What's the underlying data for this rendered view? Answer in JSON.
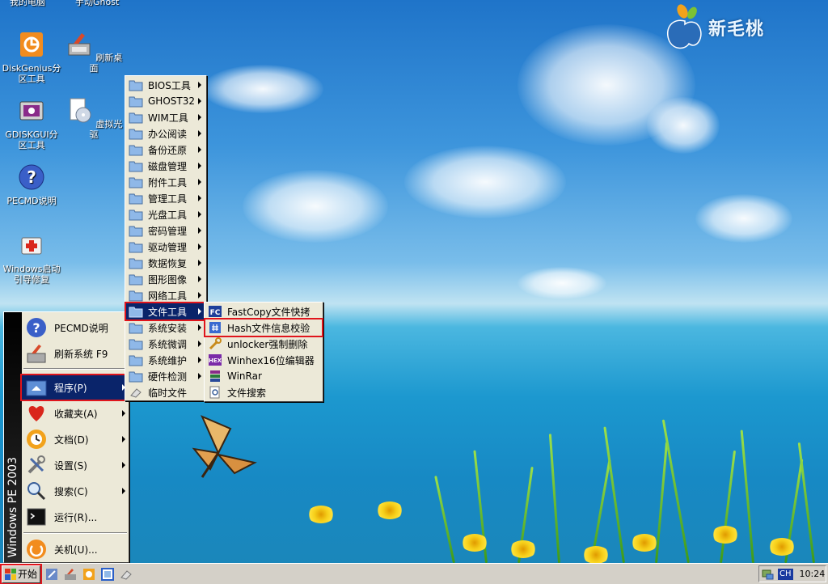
{
  "desktop": {
    "logo_text": "新毛桃",
    "top_cut_labels": [
      "我的电脑",
      "手动Ghost"
    ],
    "icons": [
      {
        "label": "DiskGenius分区工具",
        "icon": "diskgenius-icon"
      },
      {
        "label": "刷新桌面",
        "icon": "refresh-desktop-icon"
      },
      {
        "label": "GDISKGUI分区工具",
        "icon": "gdiskgui-icon"
      },
      {
        "label": "虚拟光驱",
        "icon": "virtual-drive-icon"
      },
      {
        "label": "PECMD说明",
        "icon": "help-icon"
      },
      {
        "label": "Windows启动引导修复",
        "icon": "boot-repair-icon"
      }
    ]
  },
  "start_menu": {
    "banner": "Windows PE 2003",
    "items": [
      {
        "label": "PECMD说明",
        "icon": "help-icon",
        "submenu": false
      },
      {
        "label": "刷新系统 F9",
        "icon": "refresh-icon",
        "submenu": false
      },
      {
        "label": "程序(P)",
        "icon": "programs-icon",
        "submenu": true,
        "active": true
      },
      {
        "label": "收藏夹(A)",
        "icon": "favorites-icon",
        "submenu": true
      },
      {
        "label": "文档(D)",
        "icon": "documents-icon",
        "submenu": true
      },
      {
        "label": "设置(S)",
        "icon": "settings-icon",
        "submenu": true
      },
      {
        "label": "搜索(C)",
        "icon": "search-icon",
        "submenu": true
      },
      {
        "label": "运行(R)...",
        "icon": "run-icon",
        "submenu": false
      },
      {
        "label": "关机(U)...",
        "icon": "shutdown-icon",
        "submenu": false
      }
    ]
  },
  "programs_menu": {
    "items": [
      {
        "label": "BIOS工具",
        "submenu": true
      },
      {
        "label": "GHOST32",
        "submenu": true
      },
      {
        "label": "WIM工具",
        "submenu": true
      },
      {
        "label": "办公阅读",
        "submenu": true
      },
      {
        "label": "备份还原",
        "submenu": true
      },
      {
        "label": "磁盘管理",
        "submenu": true
      },
      {
        "label": "附件工具",
        "submenu": true
      },
      {
        "label": "管理工具",
        "submenu": true
      },
      {
        "label": "光盘工具",
        "submenu": true
      },
      {
        "label": "密码管理",
        "submenu": true
      },
      {
        "label": "驱动管理",
        "submenu": true
      },
      {
        "label": "数据恢复",
        "submenu": true
      },
      {
        "label": "图形图像",
        "submenu": true
      },
      {
        "label": "网络工具",
        "submenu": true
      },
      {
        "label": "文件工具",
        "submenu": true,
        "active": true
      },
      {
        "label": "系统安装",
        "submenu": true
      },
      {
        "label": "系统微调",
        "submenu": true
      },
      {
        "label": "系统维护",
        "submenu": true
      },
      {
        "label": "硬件检测",
        "submenu": true
      },
      {
        "label": "临时文件",
        "submenu": false
      }
    ]
  },
  "file_tools_menu": {
    "items": [
      {
        "label": "FastCopy文件快拷",
        "icon": "fastcopy-icon"
      },
      {
        "label": "Hash文件信息校验",
        "icon": "hash-icon",
        "highlighted": true
      },
      {
        "label": "unlocker强制删除",
        "icon": "unlocker-icon"
      },
      {
        "label": "Winhex16位编辑器",
        "icon": "winhex-icon"
      },
      {
        "label": "WinRar",
        "icon": "winrar-icon"
      },
      {
        "label": "文件搜索",
        "icon": "file-search-icon"
      }
    ]
  },
  "taskbar": {
    "start_label": "开始",
    "input_method": "CH",
    "clock": "10:24"
  }
}
